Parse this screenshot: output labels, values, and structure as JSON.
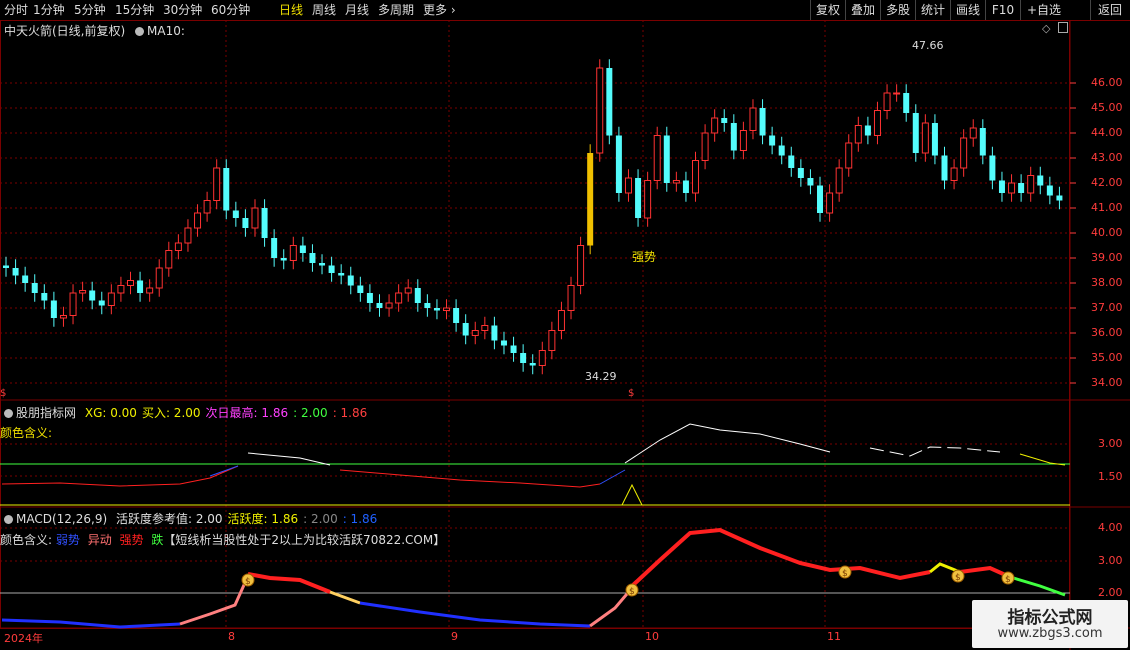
{
  "toolbar": {
    "periods": [
      "分时",
      "1分钟",
      "5分钟",
      "15分钟",
      "30分钟",
      "60分钟",
      "日线",
      "周线",
      "月线",
      "多周期",
      "更多"
    ],
    "active": "日线",
    "right_buttons": [
      "复权",
      "叠加",
      "多股",
      "统计",
      "画线",
      "F10",
      "+自选",
      "返回"
    ]
  },
  "main_panel": {
    "title": "中天火箭(日线,前复权)",
    "ma_label": "MA10:",
    "annotation_high": "47.66",
    "annotation_low": "34.29",
    "signal_label": "强势",
    "y_ticks": [
      "46.00",
      "45.00",
      "44.00",
      "43.00",
      "42.00",
      "41.00",
      "40.00",
      "39.00",
      "38.00",
      "37.00",
      "36.00",
      "35.00",
      "34.00"
    ]
  },
  "indicator1": {
    "name": "股朋指标网",
    "items": [
      {
        "label": "XG:",
        "value": "0.00",
        "color": "#f0f000"
      },
      {
        "label": "买入:",
        "value": "2.00",
        "color": "#f0f000"
      },
      {
        "label": "次日最高:",
        "value": "1.86",
        "color": "#ff40ff"
      },
      {
        "label": ":",
        "value": "2.00",
        "color": "#40ff40"
      },
      {
        "label": ":",
        "value": "1.86",
        "color": "#ff4040"
      }
    ],
    "color_meaning": "颜色含义:",
    "y_ticks": [
      "3.00",
      "1.50"
    ]
  },
  "indicator2": {
    "name": "MACD(12,26,9)",
    "items": [
      {
        "label": "活跃度参考值:",
        "value": "2.00",
        "color": "#e0e0e0"
      },
      {
        "label": "活跃度:",
        "value": "1.86",
        "color": "#f0f000"
      },
      {
        "label": ":",
        "value": "2.00",
        "color": "#888888"
      },
      {
        "label": ":",
        "value": "1.86",
        "color": "#2060ff"
      }
    ],
    "color_meaning": "颜色含义:",
    "legend": [
      {
        "text": "弱势",
        "color": "#3050ff"
      },
      {
        "text": "异动",
        "color": "#ff7070"
      },
      {
        "text": "强势",
        "color": "#ff2020"
      },
      {
        "text": "跌",
        "color": "#40ff40"
      }
    ],
    "note": "【短线析当股性处于2以上为比较活跃70822.COM】",
    "y_ticks": [
      "4.00",
      "3.00",
      "2.00"
    ]
  },
  "x_axis": [
    "2024年",
    "8",
    "9",
    "10",
    "11"
  ],
  "watermark": {
    "title": "指标公式网",
    "url": "www.zbgs3.com"
  },
  "colors": {
    "up": "#ff3232",
    "down": "#54fcfc",
    "grid": "#7a0000",
    "accent": "#f0e000"
  }
}
